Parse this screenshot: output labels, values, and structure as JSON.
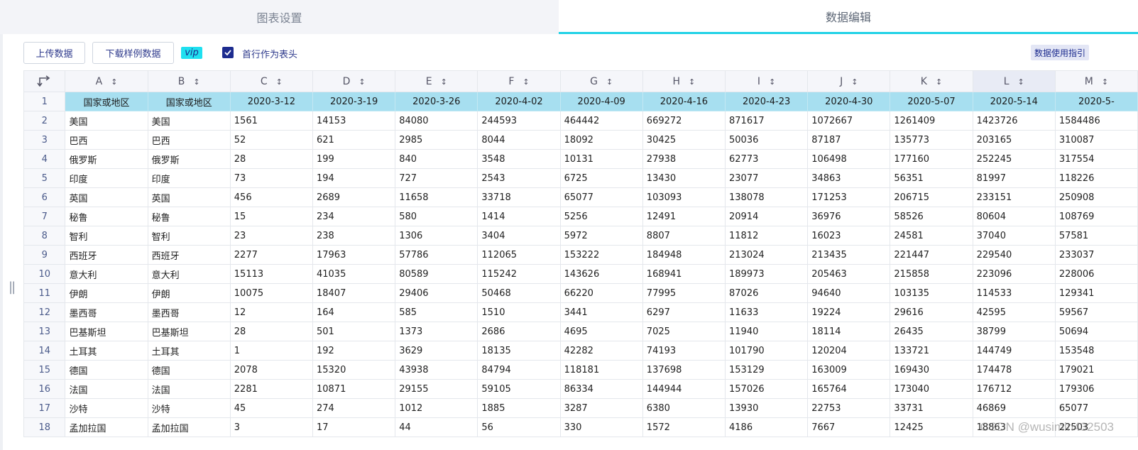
{
  "tabs": {
    "chart_settings": "图表设置",
    "data_edit": "数据编辑"
  },
  "toolbar": {
    "upload": "上传数据",
    "download_sample": "下载样例数据",
    "vip": "vip",
    "first_row_header": "首行作为表头",
    "first_row_header_checked": true,
    "guide": "数据使用指引"
  },
  "grid": {
    "columns": [
      "A",
      "B",
      "C",
      "D",
      "E",
      "F",
      "G",
      "H",
      "I",
      "J",
      "K",
      "L",
      "M"
    ],
    "header_row": [
      "国家或地区",
      "国家或地区",
      "2020-3-12",
      "2020-3-19",
      "2020-3-26",
      "2020-4-02",
      "2020-4-09",
      "2020-4-16",
      "2020-4-23",
      "2020-4-30",
      "2020-5-07",
      "2020-5-14",
      "2020-5-"
    ],
    "rows": [
      [
        "美国",
        "美国",
        "1561",
        "14153",
        "84080",
        "244593",
        "464442",
        "669272",
        "871617",
        "1072667",
        "1261409",
        "1423726",
        "1584486"
      ],
      [
        "巴西",
        "巴西",
        "52",
        "621",
        "2985",
        "8044",
        "18092",
        "30425",
        "50036",
        "87187",
        "135773",
        "203165",
        "310087"
      ],
      [
        "俄罗斯",
        "俄罗斯",
        "28",
        "199",
        "840",
        "3548",
        "10131",
        "27938",
        "62773",
        "106498",
        "177160",
        "252245",
        "317554"
      ],
      [
        "印度",
        "印度",
        "73",
        "194",
        "727",
        "2543",
        "6725",
        "13430",
        "23077",
        "34863",
        "56351",
        "81997",
        "118226"
      ],
      [
        "英国",
        "英国",
        "456",
        "2689",
        "11658",
        "33718",
        "65077",
        "103093",
        "138078",
        "171253",
        "206715",
        "233151",
        "250908"
      ],
      [
        "秘鲁",
        "秘鲁",
        "15",
        "234",
        "580",
        "1414",
        "5256",
        "12491",
        "20914",
        "36976",
        "58526",
        "80604",
        "108769"
      ],
      [
        "智利",
        "智利",
        "23",
        "238",
        "1306",
        "3404",
        "5972",
        "8807",
        "11812",
        "16023",
        "24581",
        "37040",
        "57581"
      ],
      [
        "西班牙",
        "西班牙",
        "2277",
        "17963",
        "57786",
        "112065",
        "153222",
        "184948",
        "213024",
        "213435",
        "221447",
        "229540",
        "233037"
      ],
      [
        "意大利",
        "意大利",
        "15113",
        "41035",
        "80589",
        "115242",
        "143626",
        "168941",
        "189973",
        "205463",
        "215858",
        "223096",
        "228006"
      ],
      [
        "伊朗",
        "伊朗",
        "10075",
        "18407",
        "29406",
        "50468",
        "66220",
        "77995",
        "87026",
        "94640",
        "103135",
        "114533",
        "129341"
      ],
      [
        "墨西哥",
        "墨西哥",
        "12",
        "164",
        "585",
        "1510",
        "3441",
        "6297",
        "11633",
        "19224",
        "29616",
        "42595",
        "59567"
      ],
      [
        "巴基斯坦",
        "巴基斯坦",
        "28",
        "501",
        "1373",
        "2686",
        "4695",
        "7025",
        "11940",
        "18114",
        "26435",
        "38799",
        "50694"
      ],
      [
        "土耳其",
        "土耳其",
        "1",
        "192",
        "3629",
        "18135",
        "42282",
        "74193",
        "101790",
        "120204",
        "133721",
        "144749",
        "153548"
      ],
      [
        "德国",
        "德国",
        "2078",
        "15320",
        "43938",
        "84794",
        "118181",
        "137698",
        "153129",
        "163009",
        "169430",
        "174478",
        "179021"
      ],
      [
        "法国",
        "法国",
        "2281",
        "10871",
        "29155",
        "59105",
        "86334",
        "144944",
        "157026",
        "165764",
        "173040",
        "176712",
        "179306"
      ],
      [
        "沙特",
        "沙特",
        "45",
        "274",
        "1012",
        "1885",
        "3287",
        "6380",
        "13930",
        "22753",
        "33731",
        "46869",
        "65077"
      ],
      [
        "孟加拉国",
        "孟加拉国",
        "3",
        "17",
        "44",
        "56",
        "330",
        "1572",
        "4186",
        "7667",
        "12425",
        "18863",
        "22503"
      ]
    ]
  },
  "watermark": "CSDN @wusimin432503"
}
